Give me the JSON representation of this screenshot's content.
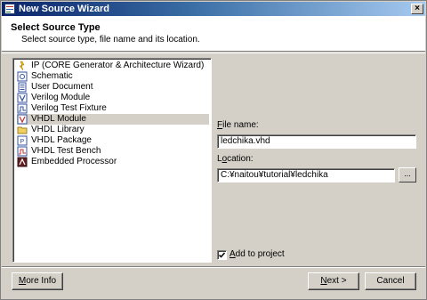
{
  "window": {
    "title": "New Source Wizard",
    "close_glyph": "×"
  },
  "header": {
    "title": "Select Source Type",
    "subtitle": "Select source type, file name and its location."
  },
  "source_types": [
    {
      "label": "IP (CORE Generator & Architecture Wizard)",
      "icon": "ip-core-icon",
      "selected": false
    },
    {
      "label": "Schematic",
      "icon": "schematic-icon",
      "selected": false
    },
    {
      "label": "User Document",
      "icon": "document-icon",
      "selected": false
    },
    {
      "label": "Verilog Module",
      "icon": "verilog-module-icon",
      "selected": false
    },
    {
      "label": "Verilog Test Fixture",
      "icon": "test-fixture-icon",
      "selected": false
    },
    {
      "label": "VHDL Module",
      "icon": "vhdl-module-icon",
      "selected": true
    },
    {
      "label": "VHDL Library",
      "icon": "vhdl-library-icon",
      "selected": false
    },
    {
      "label": "VHDL Package",
      "icon": "vhdl-package-icon",
      "selected": false
    },
    {
      "label": "VHDL Test Bench",
      "icon": "vhdl-testbench-icon",
      "selected": false
    },
    {
      "label": "Embedded Processor",
      "icon": "embedded-processor-icon",
      "selected": false
    }
  ],
  "file_name": {
    "label_prefix": "",
    "label_mnemonic": "F",
    "label_rest": "ile name:",
    "value": "ledchika.vhd"
  },
  "location": {
    "label_prefix": "L",
    "label_mnemonic": "o",
    "label_rest": "cation:",
    "value": "C:¥naitou¥tutorial¥ledchika",
    "browse_label": "..."
  },
  "add_to_project": {
    "checked": true,
    "check_glyph": "✓",
    "label_mnemonic": "A",
    "label_rest": "dd to project"
  },
  "buttons": {
    "more_info": {
      "mnemonic": "M",
      "rest": "ore Info"
    },
    "next": {
      "mnemonic": "N",
      "rest": "ext >"
    },
    "cancel": "Cancel"
  }
}
